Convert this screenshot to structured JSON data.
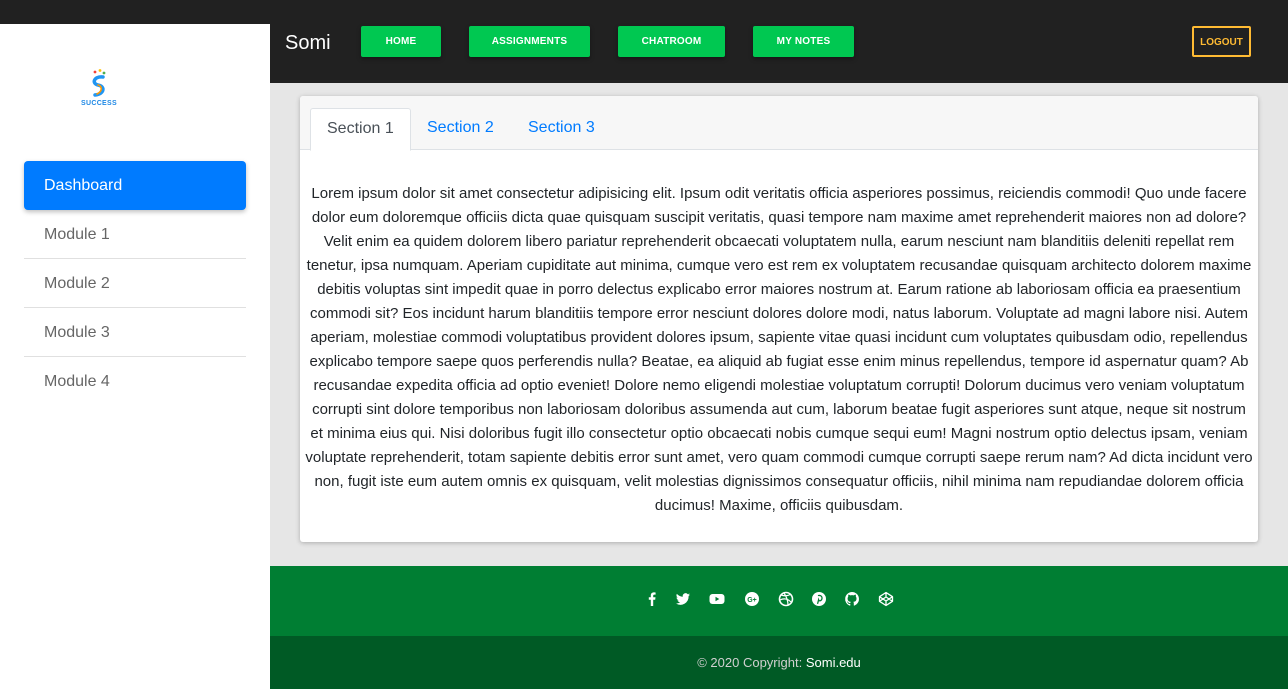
{
  "logo": {
    "word": "SUCCESS"
  },
  "sidebar": {
    "items": [
      {
        "label": "Dashboard",
        "active": true
      },
      {
        "label": "Module 1"
      },
      {
        "label": "Module 2"
      },
      {
        "label": "Module 3"
      },
      {
        "label": "Module 4"
      }
    ]
  },
  "navbar": {
    "brand": "Somi",
    "buttons": [
      "HOME",
      "ASSIGNMENTS",
      "CHATROOM",
      "MY NOTES"
    ],
    "logout": "LOGOUT"
  },
  "tabs": [
    "Section 1",
    "Section 2",
    "Section 3"
  ],
  "content": {
    "text": "Lorem ipsum dolor sit amet consectetur adipisicing elit. Ipsum odit veritatis officia asperiores possimus, reiciendis commodi! Quo unde facere dolor eum doloremque officiis dicta quae quisquam suscipit veritatis, quasi tempore nam maxime amet reprehenderit maiores non ad dolore? Velit enim ea quidem dolorem libero pariatur reprehenderit obcaecati voluptatem nulla, earum nesciunt nam blanditiis deleniti repellat rem tenetur, ipsa numquam. Aperiam cupiditate aut minima, cumque vero est rem ex voluptatem recusandae quisquam architecto dolorem maxime debitis voluptas sint impedit quae in porro delectus explicabo error maiores nostrum at. Earum ratione ab laboriosam officia ea praesentium commodi sit? Eos incidunt harum blanditiis tempore error nesciunt dolores dolore modi, natus laborum. Voluptate ad magni labore nisi. Autem aperiam, molestiae commodi voluptatibus provident dolores ipsum, sapiente vitae quasi incidunt cum voluptates quibusdam odio, repellendus explicabo tempore saepe quos perferendis nulla? Beatae, ea aliquid ab fugiat esse enim minus repellendus, tempore id aspernatur quam? Ab recusandae expedita officia ad optio eveniet! Dolore nemo eligendi molestiae voluptatum corrupti! Dolorum ducimus vero veniam voluptatum corrupti sint dolore temporibus non laboriosam doloribus assumenda aut cum, laborum beatae fugit asperiores sunt atque, neque sit nostrum et minima eius qui. Nisi doloribus fugit illo consectetur optio obcaecati nobis cumque sequi eum! Magni nostrum optio delectus ipsam, veniam voluptate reprehenderit, totam sapiente debitis error sunt amet, vero quam commodi cumque corrupti saepe rerum nam? Ad dicta incidunt vero non, fugit iste eum autem omnis ex quisquam, velit molestias dignissimos consequatur officiis, nihil minima nam repudiandae dolorem officia ducimus! Maxime, officiis quibusdam."
  },
  "footer": {
    "social_icons": [
      "facebook-icon",
      "twitter-icon",
      "youtube-icon",
      "google-plus-icon",
      "dribbble-icon",
      "pinterest-icon",
      "github-icon",
      "codepen-icon"
    ],
    "copyright_prefix": "© 2020 Copyright:",
    "copyright_link": "Somi.edu"
  },
  "colors": {
    "accent": "#007bff",
    "nav_button": "#00c851",
    "logout": "#ffbb33",
    "footer": "#007e33",
    "footer_bottom": "#005a25",
    "dark": "#212121"
  }
}
